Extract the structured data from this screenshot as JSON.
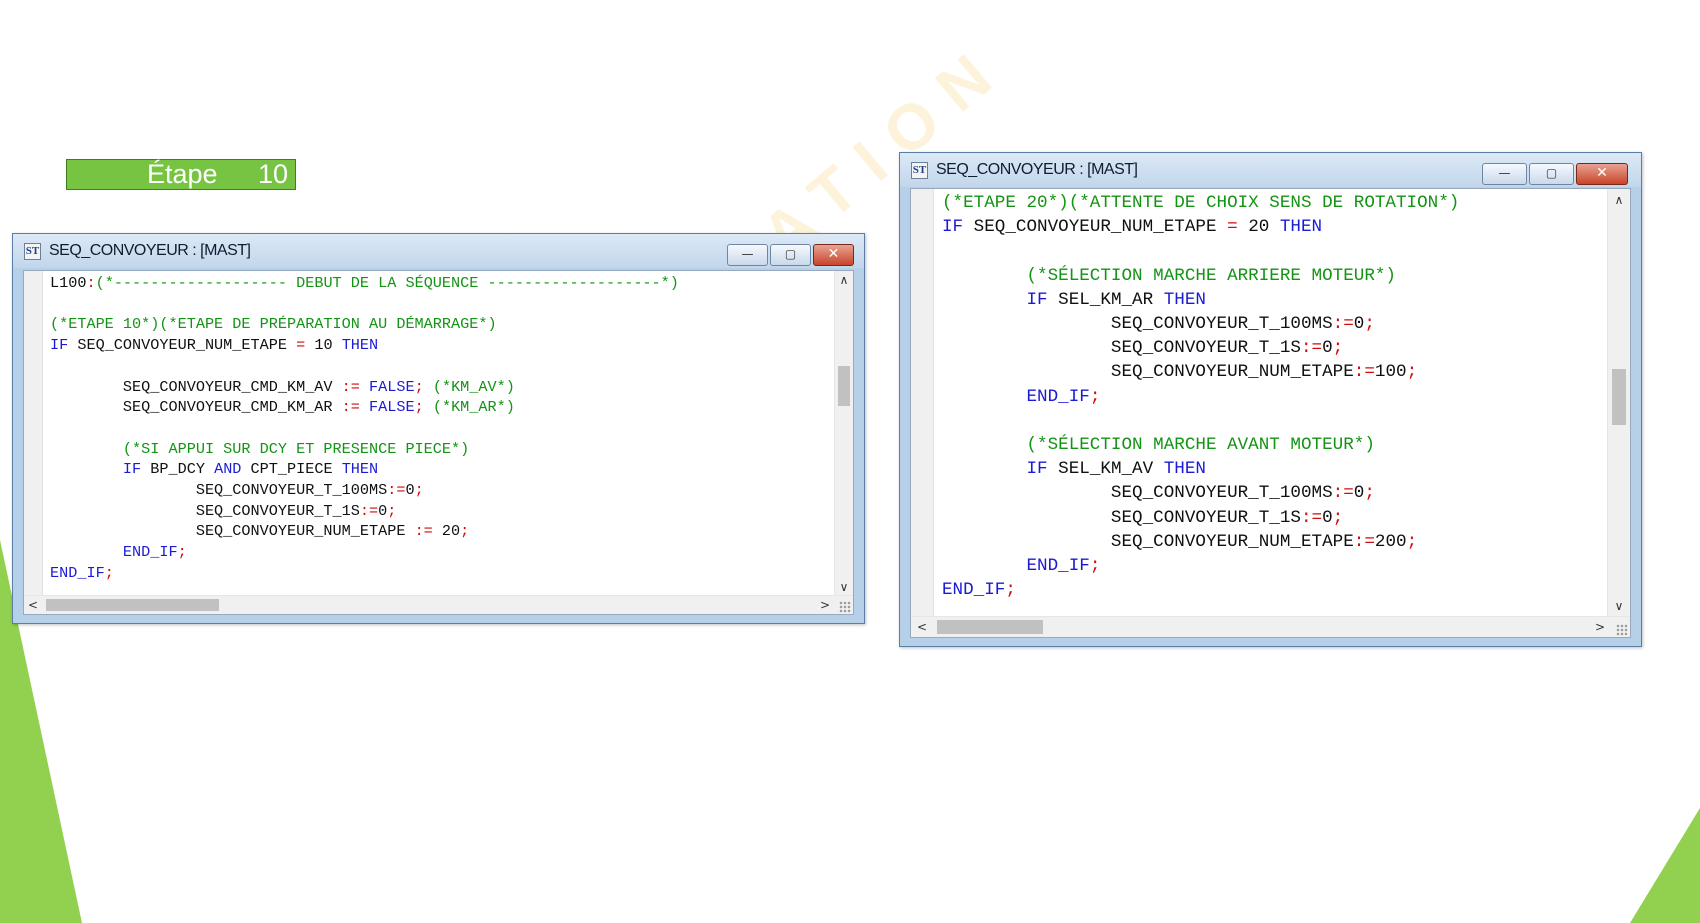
{
  "watermark": "AEI FORMATION",
  "step_label": {
    "word": "Étape",
    "number": "10"
  },
  "windows": [
    {
      "icon_text": "ST",
      "title": "SEQ_CONVOYEUR : [MAST]",
      "controls": {
        "minimize": "—",
        "maximize": "▢",
        "close": "✕"
      },
      "scroll": {
        "up": "∧",
        "down": "∨",
        "left": "<",
        "right": ">"
      },
      "lines": [
        [
          [
            "t",
            "L100"
          ],
          [
            "o",
            ":"
          ],
          [
            "c",
            "(*------------------- DEBUT DE LA SÉQUENCE -------------------*)"
          ]
        ],
        [],
        [
          [
            "c",
            "(*ETAPE 10*)(*ETAPE DE PRÉPARATION AU DÉMARRAGE*)"
          ]
        ],
        [
          [
            "k",
            "IF"
          ],
          [
            "t",
            " SEQ_CONVOYEUR_NUM_ETAPE "
          ],
          [
            "o",
            "="
          ],
          [
            "t",
            " 10 "
          ],
          [
            "k",
            "THEN"
          ]
        ],
        [],
        [
          [
            "t",
            "        SEQ_CONVOYEUR_CMD_KM_AV "
          ],
          [
            "o",
            ":="
          ],
          [
            "t",
            " "
          ],
          [
            "k",
            "FALSE"
          ],
          [
            "o",
            ";"
          ],
          [
            "t",
            " "
          ],
          [
            "c",
            "(*KM_AV*)"
          ]
        ],
        [
          [
            "t",
            "        SEQ_CONVOYEUR_CMD_KM_AR "
          ],
          [
            "o",
            ":="
          ],
          [
            "t",
            " "
          ],
          [
            "k",
            "FALSE"
          ],
          [
            "o",
            ";"
          ],
          [
            "t",
            " "
          ],
          [
            "c",
            "(*KM_AR*)"
          ]
        ],
        [],
        [
          [
            "c",
            "        (*SI APPUI SUR DCY ET PRESENCE PIECE*)"
          ]
        ],
        [
          [
            "t",
            "        "
          ],
          [
            "k",
            "IF"
          ],
          [
            "t",
            " BP_DCY "
          ],
          [
            "k",
            "AND"
          ],
          [
            "t",
            " CPT_PIECE "
          ],
          [
            "k",
            "THEN"
          ]
        ],
        [
          [
            "t",
            "                SEQ_CONVOYEUR_T_100MS"
          ],
          [
            "o",
            ":="
          ],
          [
            "t",
            "0"
          ],
          [
            "o",
            ";"
          ]
        ],
        [
          [
            "t",
            "                SEQ_CONVOYEUR_T_1S"
          ],
          [
            "o",
            ":="
          ],
          [
            "t",
            "0"
          ],
          [
            "o",
            ";"
          ]
        ],
        [
          [
            "t",
            "                SEQ_CONVOYEUR_NUM_ETAPE "
          ],
          [
            "o",
            ":="
          ],
          [
            "t",
            " 20"
          ],
          [
            "o",
            ";"
          ]
        ],
        [
          [
            "t",
            "        "
          ],
          [
            "k",
            "END_IF"
          ],
          [
            "o",
            ";"
          ]
        ],
        [
          [
            "k",
            "END_IF"
          ],
          [
            "o",
            ";"
          ]
        ]
      ]
    },
    {
      "icon_text": "ST",
      "title": "SEQ_CONVOYEUR : [MAST]",
      "controls": {
        "minimize": "—",
        "maximize": "▢",
        "close": "✕"
      },
      "scroll": {
        "up": "∧",
        "down": "∨",
        "left": "<",
        "right": ">"
      },
      "lines": [
        [
          [
            "c",
            "(*ETAPE 20*)(*ATTENTE DE CHOIX SENS DE ROTATION*)"
          ]
        ],
        [
          [
            "k",
            "IF"
          ],
          [
            "t",
            " SEQ_CONVOYEUR_NUM_ETAPE "
          ],
          [
            "o",
            "="
          ],
          [
            "t",
            " 20 "
          ],
          [
            "k",
            "THEN"
          ]
        ],
        [],
        [
          [
            "c",
            "        (*SÉLECTION MARCHE ARRIERE MOTEUR*)"
          ]
        ],
        [
          [
            "t",
            "        "
          ],
          [
            "k",
            "IF"
          ],
          [
            "t",
            " SEL_KM_AR "
          ],
          [
            "k",
            "THEN"
          ]
        ],
        [
          [
            "t",
            "                SEQ_CONVOYEUR_T_100MS"
          ],
          [
            "o",
            ":="
          ],
          [
            "t",
            "0"
          ],
          [
            "o",
            ";"
          ]
        ],
        [
          [
            "t",
            "                SEQ_CONVOYEUR_T_1S"
          ],
          [
            "o",
            ":="
          ],
          [
            "t",
            "0"
          ],
          [
            "o",
            ";"
          ]
        ],
        [
          [
            "t",
            "                SEQ_CONVOYEUR_NUM_ETAPE"
          ],
          [
            "o",
            ":="
          ],
          [
            "t",
            "100"
          ],
          [
            "o",
            ";"
          ]
        ],
        [
          [
            "t",
            "        "
          ],
          [
            "k",
            "END_IF"
          ],
          [
            "o",
            ";"
          ]
        ],
        [],
        [
          [
            "c",
            "        (*SÉLECTION MARCHE AVANT MOTEUR*)"
          ]
        ],
        [
          [
            "t",
            "        "
          ],
          [
            "k",
            "IF"
          ],
          [
            "t",
            " SEL_KM_AV "
          ],
          [
            "k",
            "THEN"
          ]
        ],
        [
          [
            "t",
            "                SEQ_CONVOYEUR_T_100MS"
          ],
          [
            "o",
            ":="
          ],
          [
            "t",
            "0"
          ],
          [
            "o",
            ";"
          ]
        ],
        [
          [
            "t",
            "                SEQ_CONVOYEUR_T_1S"
          ],
          [
            "o",
            ":="
          ],
          [
            "t",
            "0"
          ],
          [
            "o",
            ";"
          ]
        ],
        [
          [
            "t",
            "                SEQ_CONVOYEUR_NUM_ETAPE"
          ],
          [
            "o",
            ":="
          ],
          [
            "t",
            "200"
          ],
          [
            "o",
            ";"
          ]
        ],
        [
          [
            "t",
            "        "
          ],
          [
            "k",
            "END_IF"
          ],
          [
            "o",
            ";"
          ]
        ],
        [
          [
            "k",
            "END_IF"
          ],
          [
            "o",
            ";"
          ]
        ]
      ]
    }
  ]
}
